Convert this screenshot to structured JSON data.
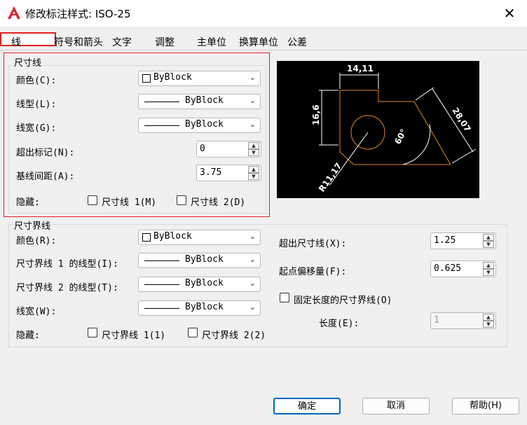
{
  "window": {
    "title": "修改标注样式: ISO-25",
    "close_symbol": "✕"
  },
  "tabs": [
    "线",
    "符号和箭头",
    "文字",
    "调整",
    "主单位",
    "换算单位",
    "公差"
  ],
  "dimension_lines": {
    "group_title": "尺寸线",
    "color_label": "颜色(C):",
    "color_value": "ByBlock",
    "linetype_label": "线型(L):",
    "linetype_value": "ByBlock",
    "lineweight_label": "线宽(G):",
    "lineweight_value": "ByBlock",
    "extend_ticks_label": "超出标记(N):",
    "extend_ticks_value": "0",
    "baseline_spacing_label": "基线间距(A):",
    "baseline_spacing_value": "3.75",
    "suppress_label": "隐藏:",
    "suppress_dim1": "尺寸线 1(M)",
    "suppress_dim2": "尺寸线 2(D)"
  },
  "extension_lines": {
    "group_title": "尺寸界线",
    "color_label": "颜色(R):",
    "color_value": "ByBlock",
    "ext1_linetype_label": "尺寸界线 1 的线型(I):",
    "ext1_linetype_value": "ByBlock",
    "ext2_linetype_label": "尺寸界线 2 的线型(T):",
    "ext2_linetype_value": "ByBlock",
    "lineweight_label": "线宽(W):",
    "lineweight_value": "ByBlock",
    "suppress_label": "隐藏:",
    "suppress_ext1": "尺寸界线 1(1)",
    "suppress_ext2": "尺寸界线 2(2)",
    "extend_beyond_label": "超出尺寸线(X):",
    "extend_beyond_value": "1.25",
    "offset_label": "起点偏移量(F):",
    "offset_value": "0.625",
    "fixed_length_label": "固定长度的尺寸界线(O)",
    "length_label": "长度(E):",
    "length_value": "1"
  },
  "preview": {
    "dim_top": "14,11",
    "dim_left": "16,6",
    "dim_diag": "28,07",
    "dim_angle": "60°",
    "dim_radius": "R11,17"
  },
  "buttons": {
    "ok": "确定",
    "cancel": "取消",
    "help": "帮助(H)"
  },
  "colors": {
    "highlight": "#e02020",
    "accent": "#0067c0",
    "preview_bg": "#000000",
    "shape_outline": "#e08a1e"
  }
}
